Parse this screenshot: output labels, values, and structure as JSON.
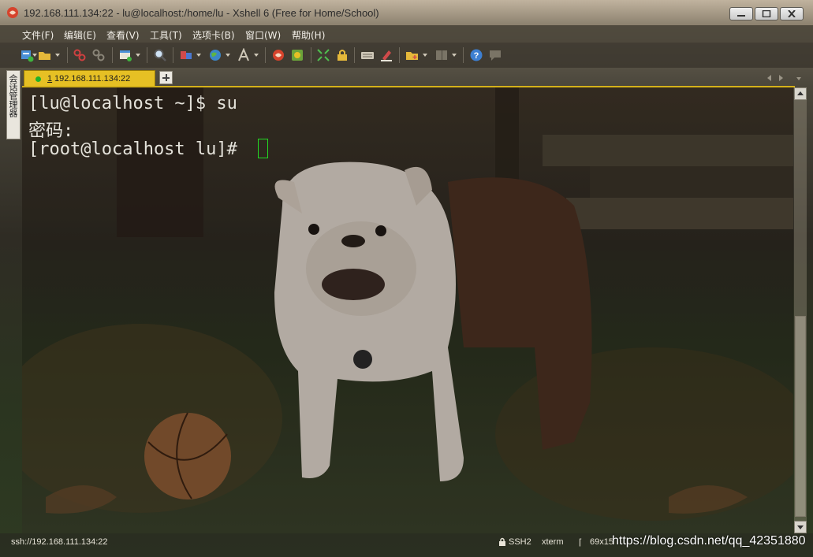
{
  "window": {
    "title": "192.168.111.134:22 - lu@localhost:/home/lu - Xshell 6 (Free for Home/School)",
    "controls": [
      "minimize-icon",
      "maximize-icon",
      "close-icon"
    ]
  },
  "menubar": {
    "items": [
      "文件(F)",
      "编辑(E)",
      "查看(V)",
      "工具(T)",
      "选项卡(B)",
      "窗口(W)",
      "帮助(H)"
    ]
  },
  "toolbar": {
    "icons": [
      "new-session-icon",
      "open-folder-icon",
      "connect-icon",
      "disconnect-icon",
      "new-window-icon",
      "find-icon",
      "properties-icon",
      "globe-icon",
      "font-icon",
      "xftp-icon",
      "xmanager-icon",
      "fullscreen-icon",
      "lock-icon",
      "keyboard-icon",
      "highlight-icon",
      "add-folder-icon",
      "layout-icon",
      "help-icon",
      "chat-icon"
    ]
  },
  "sidebar": {
    "label": "会话管理器"
  },
  "tabs": {
    "items": [
      {
        "number": "1",
        "label": "192.168.111.134:22",
        "status_color": "#1fb128",
        "active": true
      }
    ]
  },
  "terminal": {
    "lines": [
      "[lu@localhost ~]$ su",
      "密码:",
      "[root@localhost lu]# "
    ],
    "cursor_color": "#23d923",
    "background": "bulldog-photo"
  },
  "statusbar": {
    "connection": "ssh://192.168.111.134:22",
    "protocol": "SSH2",
    "terminal_type": "xterm",
    "size": "69x15"
  },
  "watermark": "https://blog.csdn.net/qq_42351880",
  "colors": {
    "tab_active": "#e6c024",
    "terminal_text": "#e4e2da",
    "cursor": "#23d923"
  }
}
